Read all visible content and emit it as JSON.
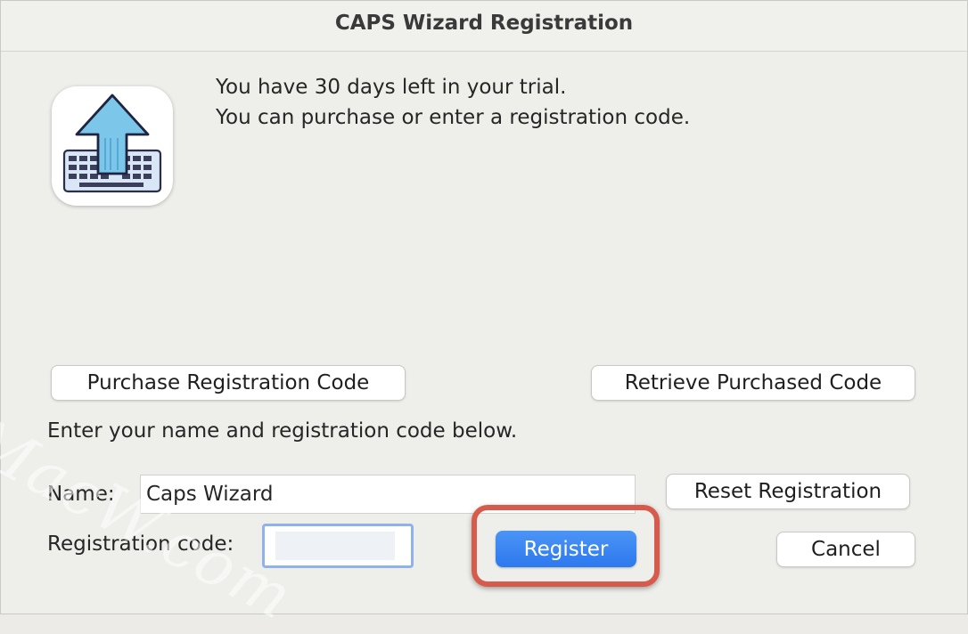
{
  "window": {
    "title": "CAPS Wizard Registration"
  },
  "app_icon": "caps-lock-arrow-keyboard-icon",
  "message": {
    "line1": "You have 30 days left in your trial.",
    "line2": "You can purchase or enter a registration code."
  },
  "buttons": {
    "purchase": "Purchase Registration Code",
    "retrieve": "Retrieve Purchased Code",
    "reset": "Reset Registration",
    "register": "Register",
    "cancel": "Cancel"
  },
  "form": {
    "instruction": "Enter your name and registration code below.",
    "name_label": "Name:",
    "name_value": "Caps Wizard",
    "code_label": "Registration code:",
    "code_value": ""
  },
  "watermark": "MacW.com",
  "colors": {
    "accent": "#2d79ee",
    "highlight": "#d65b4c"
  }
}
